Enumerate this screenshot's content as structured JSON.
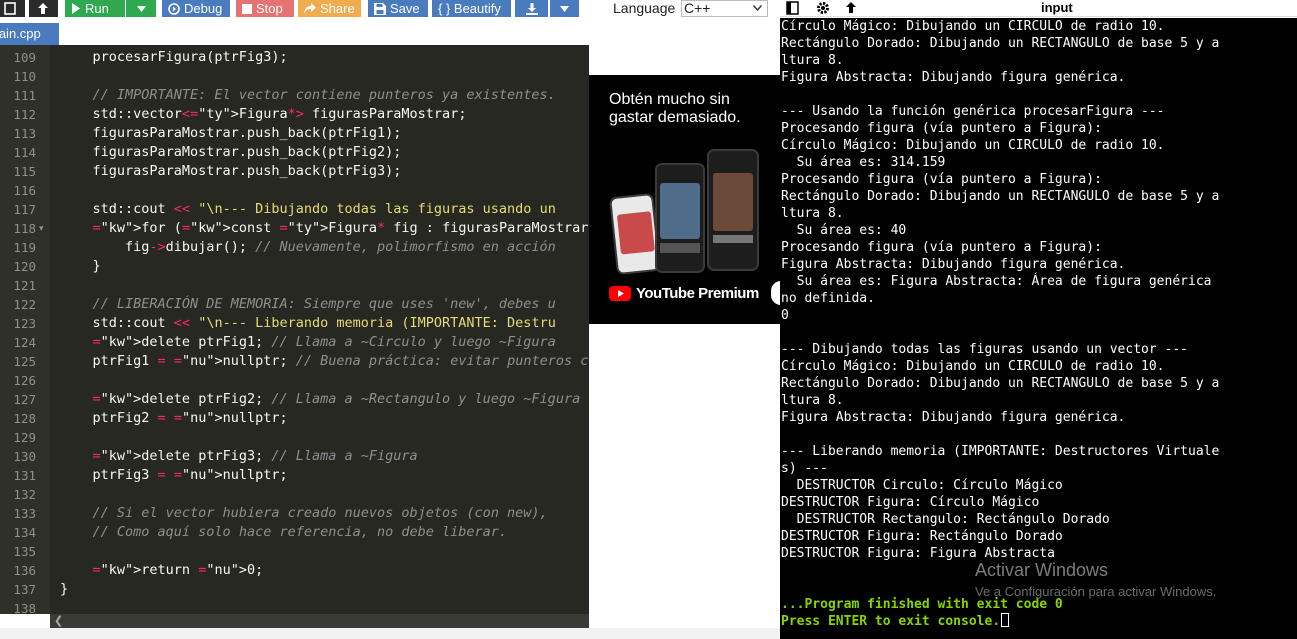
{
  "toolbar": {
    "run_label": "Run",
    "debug_label": "Debug",
    "stop_label": "Stop",
    "share_label": "Share",
    "save_label": "Save",
    "beautify_label": "{ } Beautify",
    "language_label": "Language",
    "language_value": "C++",
    "colors": {
      "run": "#2fa84f",
      "blue": "#4b7bbf",
      "stop": "#e57373",
      "share": "#f0ad4e"
    }
  },
  "file_tab": {
    "label": "main.cpp"
  },
  "editor": {
    "lines": [
      {
        "n": "109",
        "code": "    procesarFigura(ptrFig3);"
      },
      {
        "n": "110",
        "code": ""
      },
      {
        "n": "111",
        "code": "    // IMPORTANTE: El vector contiene punteros ya existentes."
      },
      {
        "n": "112",
        "code": "    std::vector<Figura*> figurasParaMostrar;"
      },
      {
        "n": "113",
        "code": "    figurasParaMostrar.push_back(ptrFig1);"
      },
      {
        "n": "114",
        "code": "    figurasParaMostrar.push_back(ptrFig2);"
      },
      {
        "n": "115",
        "code": "    figurasParaMostrar.push_back(ptrFig3);"
      },
      {
        "n": "116",
        "code": ""
      },
      {
        "n": "117",
        "code": "    std::cout << \"\\n--- Dibujando todas las figuras usando un"
      },
      {
        "n": "118",
        "code": "    for (const Figura* fig : figurasParaMostrar) {"
      },
      {
        "n": "119",
        "code": "        fig->dibujar(); // Nuevamente, polimorfismo en acción"
      },
      {
        "n": "120",
        "code": "    }"
      },
      {
        "n": "121",
        "code": ""
      },
      {
        "n": "122",
        "code": "    // LIBERACIÓN DE MEMORIA: Siempre que uses 'new', debes u"
      },
      {
        "n": "123",
        "code": "    std::cout << \"\\n--- Liberando memoria (IMPORTANTE: Destru"
      },
      {
        "n": "124",
        "code": "    delete ptrFig1; // Llama a ~Circulo y luego ~Figura"
      },
      {
        "n": "125",
        "code": "    ptrFig1 = nullptr; // Buena práctica: evitar punteros col"
      },
      {
        "n": "126",
        "code": ""
      },
      {
        "n": "127",
        "code": "    delete ptrFig2; // Llama a ~Rectangulo y luego ~Figura"
      },
      {
        "n": "128",
        "code": "    ptrFig2 = nullptr;"
      },
      {
        "n": "129",
        "code": ""
      },
      {
        "n": "130",
        "code": "    delete ptrFig3; // Llama a ~Figura"
      },
      {
        "n": "131",
        "code": "    ptrFig3 = nullptr;"
      },
      {
        "n": "132",
        "code": ""
      },
      {
        "n": "133",
        "code": "    // Si el vector hubiera creado nuevos objetos (con new),"
      },
      {
        "n": "134",
        "code": "    // Como aquí solo hace referencia, no debe liberar."
      },
      {
        "n": "135",
        "code": ""
      },
      {
        "n": "136",
        "code": "    return 0;"
      },
      {
        "n": "137",
        "code": "}"
      },
      {
        "n": "138",
        "code": ""
      },
      {
        "n": "139",
        "code": ""
      }
    ]
  },
  "ad": {
    "headline": "Obtén mucho sin gastar demasiado.",
    "brand": "YouTube Premium"
  },
  "console": {
    "title": "input",
    "lines": [
      "Círculo Mágico: Dibujando un CIRCULO de radio 10.",
      "Rectángulo Dorado: Dibujando un RECTANGULO de base 5 y a",
      "ltura 8.",
      "Figura Abstracta: Dibujando figura genérica.",
      "",
      "--- Usando la función genérica procesarFigura ---",
      "Procesando figura (vía puntero a Figura):",
      "Círculo Mágico: Dibujando un CIRCULO de radio 10.",
      "  Su área es: 314.159",
      "Procesando figura (vía puntero a Figura):",
      "Rectángulo Dorado: Dibujando un RECTANGULO de base 5 y a",
      "ltura 8.",
      "  Su área es: 40",
      "Procesando figura (vía puntero a Figura):",
      "Figura Abstracta: Dibujando figura genérica.",
      "  Su área es: Figura Abstracta: Área de figura genérica",
      "no definida.",
      "0",
      "",
      "--- Dibujando todas las figuras usando un vector ---",
      "Círculo Mágico: Dibujando un CIRCULO de radio 10.",
      "Rectángulo Dorado: Dibujando un RECTANGULO de base 5 y a",
      "ltura 8.",
      "Figura Abstracta: Dibujando figura genérica.",
      "",
      "--- Liberando memoria (IMPORTANTE: Destructores Virtuale",
      "s) ---",
      "  DESTRUCTOR Circulo: Círculo Mágico",
      "DESTRUCTOR Figura: Círculo Mágico",
      "  DESTRUCTOR Rectangulo: Rectángulo Dorado",
      "DESTRUCTOR Figura: Rectángulo Dorado",
      "DESTRUCTOR Figura: Figura Abstracta",
      "",
      "",
      "...Program finished with exit code 0",
      "Press ENTER to exit console."
    ],
    "watermark_title": "Activar Windows",
    "watermark_sub": "Ve a Configuración para activar Windows."
  }
}
